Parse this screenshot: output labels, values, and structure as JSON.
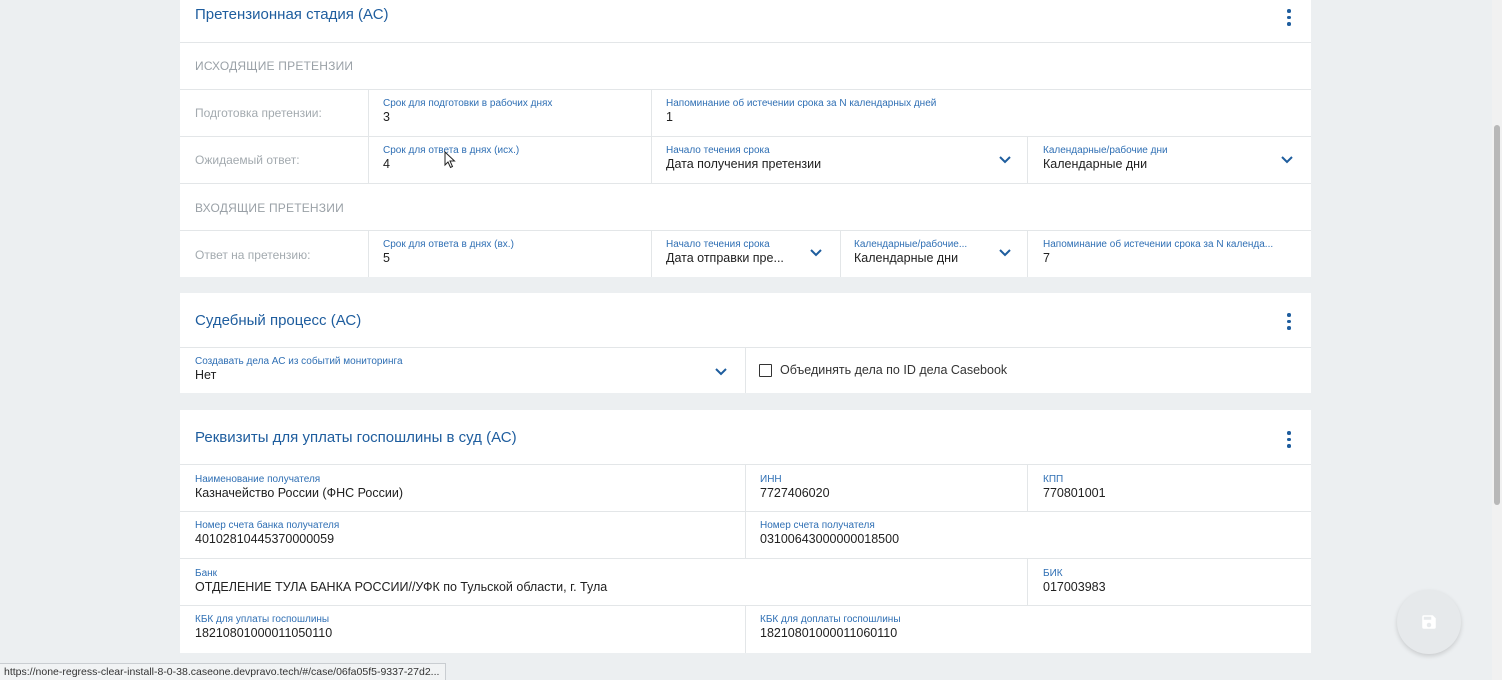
{
  "claims_card": {
    "title": "Претензионная стадия (АС)",
    "outgoing_caption": "ИСХОДЯЩИЕ ПРЕТЕНЗИИ",
    "prep": {
      "label": "Подготовка претензии:",
      "deadline": {
        "label": "Срок для подготовки в рабочих днях",
        "value": "3"
      },
      "reminder": {
        "label": "Напоминание об истечении срока за N календарных дней",
        "value": "1"
      }
    },
    "expected": {
      "label": "Ожидаемый ответ:",
      "deadline": {
        "label": "Срок для ответа в днях (исх.)",
        "value": "4"
      },
      "start": {
        "label": "Начало течения срока",
        "value": "Дата получения претензии"
      },
      "days_type": {
        "label": "Календарные/рабочие дни",
        "value": "Календарные дни"
      }
    },
    "incoming_caption": "ВХОДЯЩИЕ ПРЕТЕНЗИИ",
    "reply": {
      "label": "Ответ на претензию:",
      "deadline": {
        "label": "Срок для ответа в днях (вх.)",
        "value": "5"
      },
      "start": {
        "label": "Начало течения срока",
        "value": "Дата отправки пре..."
      },
      "days_type": {
        "label": "Календарные/рабочие...",
        "value": "Календарные дни"
      },
      "reminder": {
        "label": "Напоминание об истечении срока за N календа...",
        "value": "7"
      }
    }
  },
  "court_card": {
    "title": "Судебный процесс (АС)",
    "create_cases": {
      "label": "Создавать дела АС из событий мониторинга",
      "value": "Нет"
    },
    "merge_checkbox": {
      "label": "Объединять дела по ID дела Casebook",
      "checked": false
    }
  },
  "fee_card": {
    "title": "Реквизиты для уплаты госпошлины в суд (АС)",
    "recipient": {
      "label": "Наименование получателя",
      "value": "Казначейство России (ФНС России)"
    },
    "inn": {
      "label": "ИНН",
      "value": "7727406020"
    },
    "kpp": {
      "label": "КПП",
      "value": "770801001"
    },
    "bank_account": {
      "label": "Номер счета банка получателя",
      "value": "40102810445370000059"
    },
    "recipient_account": {
      "label": "Номер счета получателя",
      "value": "03100643000000018500"
    },
    "bank": {
      "label": "Банк",
      "value": "ОТДЕЛЕНИЕ ТУЛА БАНКА РОССИИ//УФК по Тульской области, г. Тула"
    },
    "bik": {
      "label": "БИК",
      "value": "017003983"
    },
    "kbk_pay": {
      "label": "КБК для уплаты госпошлины",
      "value": "18210801000011050110"
    },
    "kbk_extra": {
      "label": "КБК для доплаты госпошлины",
      "value": "18210801000011060110"
    }
  },
  "status_url": "https://none-regress-clear-install-8-0-38.caseone.devpravo.tech/#/case/06fa05f5-9337-27d2...",
  "icons": {
    "save": "save-icon",
    "more": "more-vert-icon",
    "chevron": "chevron-down-icon"
  },
  "colors": {
    "accent": "#1e5d9e",
    "label": "#2f6fb4",
    "background": "#eceff1"
  }
}
